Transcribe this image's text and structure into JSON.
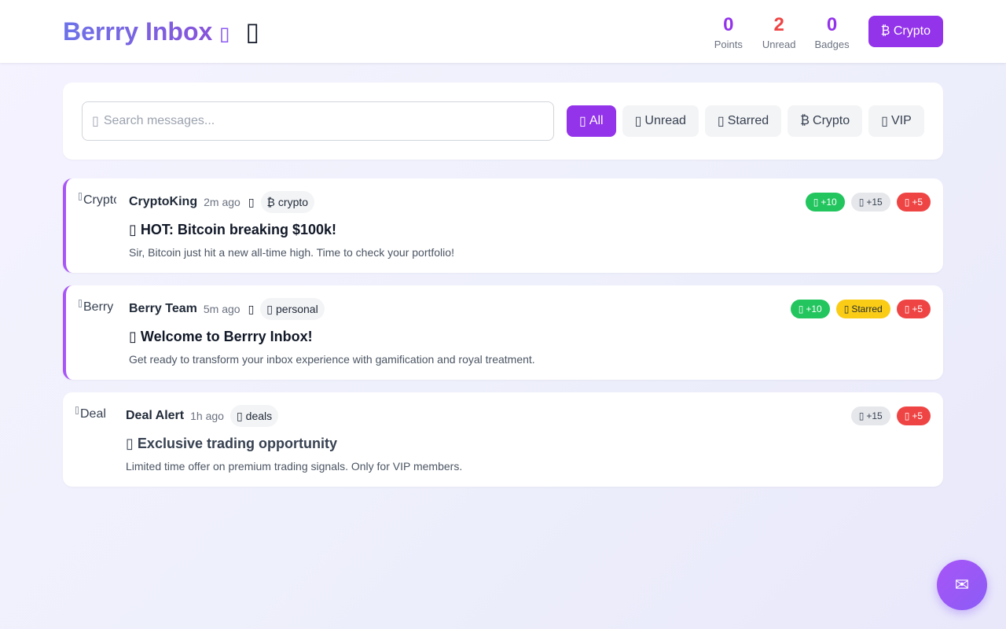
{
  "header": {
    "title": "Berrry Inbox",
    "title_glyph": "▯",
    "extra_glyph": "▯",
    "stats": [
      {
        "value": "0",
        "label": "Points",
        "color": "#9333ea"
      },
      {
        "value": "2",
        "label": "Unread",
        "color": "#ef4444"
      },
      {
        "value": "0",
        "label": "Badges",
        "color": "#9333ea"
      }
    ],
    "crypto_button": "₿ Crypto"
  },
  "search": {
    "icon_glyph": "▯",
    "placeholder": "Search messages..."
  },
  "filters": [
    {
      "icon": "▯",
      "label": "All",
      "active": true
    },
    {
      "icon": "▯",
      "label": "Unread",
      "active": false
    },
    {
      "icon": "▯",
      "label": "Starred",
      "active": false
    },
    {
      "icon": "₿",
      "label": "Crypto",
      "active": false
    },
    {
      "icon": "▯",
      "label": "VIP",
      "active": false
    }
  ],
  "messages": [
    {
      "avatar_alt": "CryptoKing",
      "sender": "CryptoKing",
      "time": "2m ago",
      "flag": "▯",
      "tag_icon": "₿",
      "tag": "crypto",
      "subject_icon": "▯",
      "subject": "HOT: Bitcoin breaking $100k!",
      "preview": "Sir, Bitcoin just hit a new all-time high. Time to check your portfolio!",
      "badges": [
        {
          "icon": "▯",
          "label": "+10",
          "style": "green"
        },
        {
          "icon": "▯",
          "label": "+15",
          "style": "gray"
        },
        {
          "icon": "▯",
          "label": "+5",
          "style": "red"
        }
      ]
    },
    {
      "avatar_alt": "Berry",
      "sender": "Berry Team",
      "time": "5m ago",
      "flag": "▯",
      "tag_icon": "▯",
      "tag": "personal",
      "subject_icon": "▯",
      "subject": "Welcome to Berrry Inbox!",
      "preview": "Get ready to transform your inbox experience with gamification and royal treatment.",
      "badges": [
        {
          "icon": "▯",
          "label": "+10",
          "style": "green"
        },
        {
          "icon": "▯",
          "label": "Starred",
          "style": "yellow"
        },
        {
          "icon": "▯",
          "label": "+5",
          "style": "red"
        }
      ]
    },
    {
      "avatar_alt": "Deal",
      "sender": "Deal Alert",
      "time": "1h ago",
      "tag_icon": "▯",
      "tag": "deals",
      "subject_icon": "▯",
      "subject": "Exclusive trading opportunity",
      "preview": "Limited time offer on premium trading signals. Only for VIP members.",
      "badges": [
        {
          "icon": "▯",
          "label": "+15",
          "style": "gray"
        },
        {
          "icon": "▯",
          "label": "+5",
          "style": "red"
        }
      ]
    }
  ],
  "fab": {
    "icon": "✉"
  }
}
